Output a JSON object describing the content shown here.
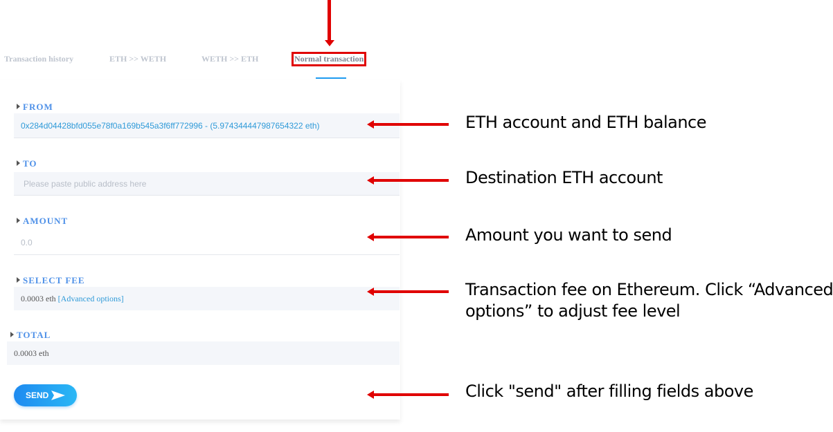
{
  "tabs": [
    {
      "label": "Transaction history"
    },
    {
      "label": "ETH >> WETH"
    },
    {
      "label": "WETH >> ETH"
    },
    {
      "label": "Normal transaction"
    }
  ],
  "form": {
    "from_label": "FROM",
    "from_value": "0x284d04428bfd055e78f0a169b545a3f6ff772996 - (5.974344447987654322 eth)",
    "to_label": "TO",
    "to_placeholder": "Please paste public address here",
    "amount_label": "AMOUNT",
    "amount_placeholder": "0.0",
    "fee_label": "SELECT FEE",
    "fee_value": "0.0003 eth",
    "fee_link": "[Advanced options]",
    "total_label": "TOTAL",
    "total_value": "0.0003 eth",
    "send_label": "SEND"
  },
  "annotations": {
    "from": "ETH account and ETH balance",
    "to": "Destination ETH account",
    "amount": "Amount you want to send",
    "fee_line1": "Transaction fee on Ethereum. Click “Advanced",
    "fee_line2": "options” to adjust fee level",
    "send": "Click \"send\" after filling fields above"
  },
  "colors": {
    "accent": "#4f91e8",
    "link": "#2f9ad8",
    "highlight": "#e00000"
  }
}
